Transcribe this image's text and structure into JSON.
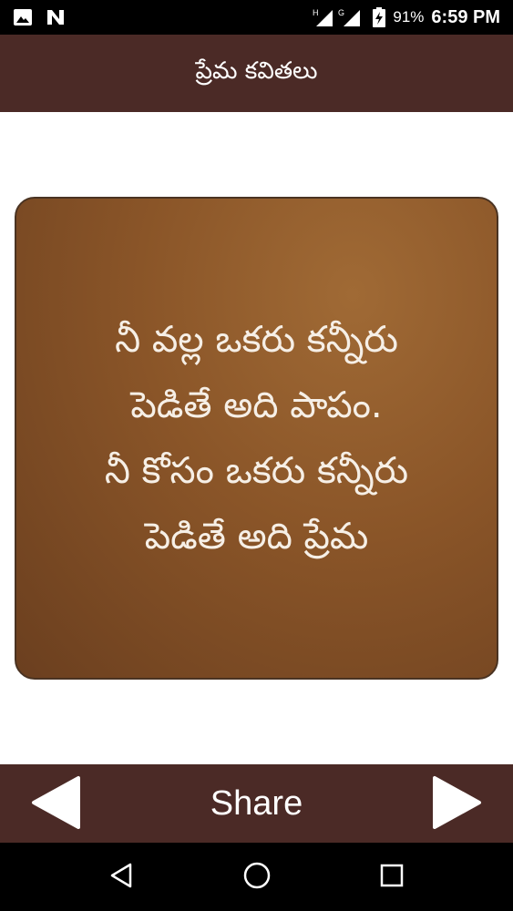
{
  "status_bar": {
    "battery_percent": "91%",
    "time": "6:59 PM",
    "network_h": "H",
    "network_g": "G",
    "icons": [
      "image-icon",
      "n-icon",
      "signal-icon",
      "battery-icon"
    ]
  },
  "header": {
    "title": "ప్రేమ కవితలు"
  },
  "quote": {
    "lines": [
      "నీ వల్ల ఒకరు కన్నీరు",
      "పెడితే అది పాపం.",
      "నీ కోసం ఒకరు కన్నీరు",
      "పెడితే అది ప్రేమ"
    ]
  },
  "bottom_bar": {
    "share_label": "Share",
    "prev_icon": "left-triangle-icon",
    "next_icon": "right-triangle-icon"
  },
  "nav_bar": {
    "icons": [
      "back-icon",
      "home-icon",
      "recents-icon"
    ]
  },
  "colors": {
    "header_bg": "#4b2a26",
    "card_bg": "#8a5528",
    "text_light": "#f6efe6"
  }
}
